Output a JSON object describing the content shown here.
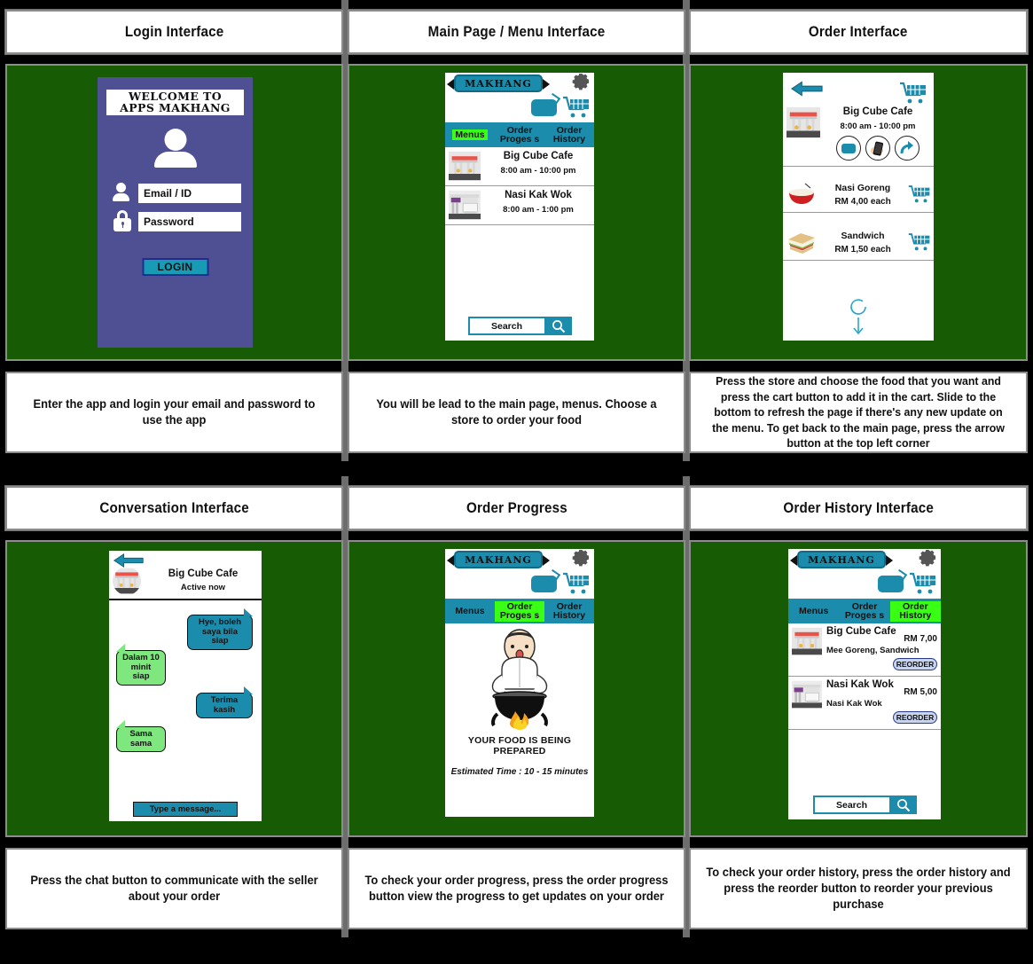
{
  "colors": {
    "stage_background": "#000000",
    "panel_background": "#175b04",
    "accent_teal": "#1b8cab",
    "login_purple": "#4f4f93",
    "active_tab_green": "#39ff14",
    "them_bubble_green": "#7ee87e",
    "reorder_blue": "#c9d4ef",
    "frame_gray": "#8c8c8c"
  },
  "panels": [
    {
      "title": "Login Interface",
      "caption": "Enter the app and login your email and password to use the app",
      "screen": {
        "welcome_line1": "WELCOME TO",
        "welcome_line2": "APPS MAKHANG",
        "avatar_icon": "user-avatar-icon",
        "fields": [
          {
            "icon": "user-icon",
            "placeholder": "Email / ID"
          },
          {
            "icon": "lock-icon",
            "placeholder": "Password"
          }
        ],
        "login_button": "LOGIN"
      }
    },
    {
      "title": "Main Page / Menu Interface",
      "caption": "You will be lead to the main page, menus. Choose a store to order your food",
      "screen": {
        "brand": "MAKHANG",
        "gear_icon": "gear-icon",
        "chat_icon": "chat-bubble-icon",
        "cart_icon": "shopping-cart-icon",
        "tabs": [
          {
            "label": "Menus",
            "active": true
          },
          {
            "label": "Order Proges s",
            "active": false
          },
          {
            "label": "Order History",
            "active": false
          }
        ],
        "stores": [
          {
            "name": "Big Cube Cafe",
            "hours": "8:00 am - 10:00 pm",
            "thumb": "cafe-storefront-icon"
          },
          {
            "name": "Nasi Kak Wok",
            "hours": "8:00 am - 1:00 pm",
            "thumb": "shop-storefront-icon"
          }
        ],
        "search_placeholder": "Search",
        "search_icon": "search-icon"
      }
    },
    {
      "title": "Order Interface",
      "caption": "Press the store and choose the food that you want and press the cart button to add it in the cart. Slide to the bottom to refresh the page if there's any new update on the menu. To get back to the main page, press the arrow button at the top left corner",
      "screen": {
        "back_icon": "back-arrow-icon",
        "cart_icon": "shopping-cart-icon",
        "store": {
          "name": "Big Cube Cafe",
          "hours": "8:00 am - 10:00 pm",
          "thumb": "cafe-storefront-icon"
        },
        "action_buttons": [
          "chat-bubble-icon",
          "phone-in-hand-icon",
          "share-arrow-icon"
        ],
        "menu_items": [
          {
            "name": "Nasi Goreng",
            "price": "RM 4,00 each",
            "thumb": "rice-bowl-icon",
            "cart_icon": "shopping-cart-icon"
          },
          {
            "name": "Sandwich",
            "price": "RM 1,50 each",
            "thumb": "sandwich-icon",
            "cart_icon": "shopping-cart-icon"
          }
        ],
        "refresh_icon": "refresh-circle-icon",
        "pull_down_icon": "down-arrow-icon"
      }
    },
    {
      "title": "Conversation Interface",
      "caption": "Press the chat button to communicate with the seller about your order",
      "screen": {
        "back_icon": "back-arrow-icon",
        "contact_name": "Big Cube Cafe",
        "contact_status": "Active now",
        "avatar": "cafe-storefront-avatar",
        "messages": [
          {
            "side": "me",
            "text": "Hye, boleh saya bila siap"
          },
          {
            "side": "them",
            "text": "Dalam 10 minit siap"
          },
          {
            "side": "me",
            "text": "Terima kasih"
          },
          {
            "side": "them",
            "text": "Sama sama"
          }
        ],
        "input_placeholder": "Type a message..."
      }
    },
    {
      "title": "Order Progress",
      "caption": "To check your order progress, press the order progress button view the progress to get updates on your order",
      "screen": {
        "brand": "MAKHANG",
        "gear_icon": "gear-icon",
        "chat_icon": "chat-bubble-icon",
        "cart_icon": "shopping-cart-icon",
        "tabs": [
          {
            "label": "Menus",
            "active": false
          },
          {
            "label": "Order Proges s",
            "active": true
          },
          {
            "label": "Order History",
            "active": false
          }
        ],
        "illustration": "chef-cooking-pot-icon",
        "status_title": "YOUR FOOD IS BEING PREPARED",
        "estimated_time": "Estimated Time : 10 - 15 minutes"
      }
    },
    {
      "title": "Order History Interface",
      "caption": "To check your order history, press the order history and press the reorder button to reorder your previous purchase",
      "screen": {
        "brand": "MAKHANG",
        "gear_icon": "gear-icon",
        "chat_icon": "chat-bubble-icon",
        "cart_icon": "shopping-cart-icon",
        "tabs": [
          {
            "label": "Menus",
            "active": false
          },
          {
            "label": "Order Proges s",
            "active": false
          },
          {
            "label": "Order History",
            "active": true
          }
        ],
        "orders": [
          {
            "store": "Big Cube Cafe",
            "price": "RM 7,00",
            "items": "Mee Goreng, Sandwich",
            "reorder_label": "REORDER",
            "thumb": "cafe-storefront-icon"
          },
          {
            "store": "Nasi Kak Wok",
            "price": "RM 5,00",
            "items": "Nasi Kak Wok",
            "reorder_label": "REORDER",
            "thumb": "shop-storefront-icon"
          }
        ],
        "search_placeholder": "Search",
        "search_icon": "search-icon"
      }
    }
  ]
}
